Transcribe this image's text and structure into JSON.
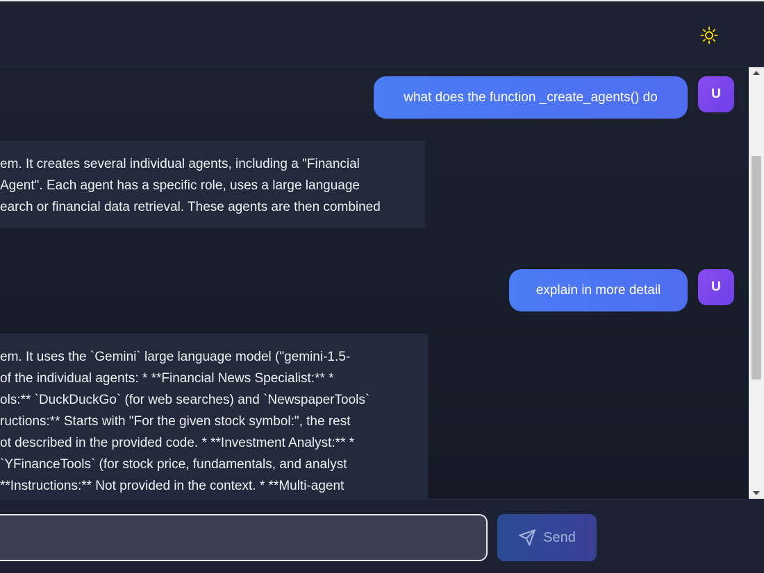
{
  "header": {
    "theme_icon": "sun-icon",
    "accent_color": "#f5d000"
  },
  "messages": [
    {
      "role": "user",
      "text": "what does the function _create_agents() do",
      "avatar": "U"
    },
    {
      "role": "assistant",
      "lines": [
        "em. It creates several individual agents, including a \"Financial",
        "Agent\". Each agent has a specific role, uses a large language",
        "earch or financial data retrieval. These agents are then combined"
      ]
    },
    {
      "role": "user",
      "text": "explain in more detail",
      "avatar": "U"
    },
    {
      "role": "assistant",
      "lines": [
        "em. It uses the `Gemini` large language model (\"gemini-1.5-",
        "of the individual agents: * **Financial News Specialist:** *",
        "ols:** `DuckDuckGo` (for web searches) and `NewspaperTools`",
        "ructions:** Starts with \"For the given stock symbol:\", the rest",
        "ot described in the provided code. * **Investment Analyst:** *",
        "`YFinanceTools` (for stock price, fundamentals, and analyst",
        "**Instructions:** Not provided in the context. * **Multi-agent"
      ]
    }
  ],
  "composer": {
    "input_value": "",
    "send_label": "Send",
    "send_icon": "send-icon"
  }
}
